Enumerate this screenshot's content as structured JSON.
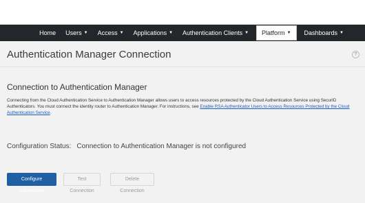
{
  "nav": {
    "items": [
      {
        "label": "Home",
        "caret": false
      },
      {
        "label": "Users",
        "caret": true
      },
      {
        "label": "Access",
        "caret": true
      },
      {
        "label": "Applications",
        "caret": true
      },
      {
        "label": "Authentication Clients",
        "caret": true
      },
      {
        "label": "Platform",
        "caret": true
      },
      {
        "label": "Dashboards",
        "caret": true
      }
    ],
    "active": "Platform"
  },
  "header": {
    "title": "Authentication Manager Connection",
    "help_icon": "?"
  },
  "section": {
    "title": "Connection to Authentication Manager",
    "description": "Connecting from the Cloud Authentication Service to Authentication Manager allows users to access resources protected by the Cloud Authentication Service using SecurID Authenticators. You must connect the identity router to Authentication Manager. For instructions, see ",
    "link_text": "Enable RSA Authenticator Users to Access Resources Protected by the Cloud Authentication Service",
    "after_link": "."
  },
  "status": {
    "label": "Configuration Status:",
    "value": "Connection to Authentication Manager is not configured"
  },
  "buttons": {
    "configure": "Configure Connection",
    "test": "Test Connection",
    "delete": "Delete Connection"
  },
  "colors": {
    "nav_bg": "#23272b",
    "primary": "#1f5fa3",
    "link": "#1a5bbf"
  }
}
